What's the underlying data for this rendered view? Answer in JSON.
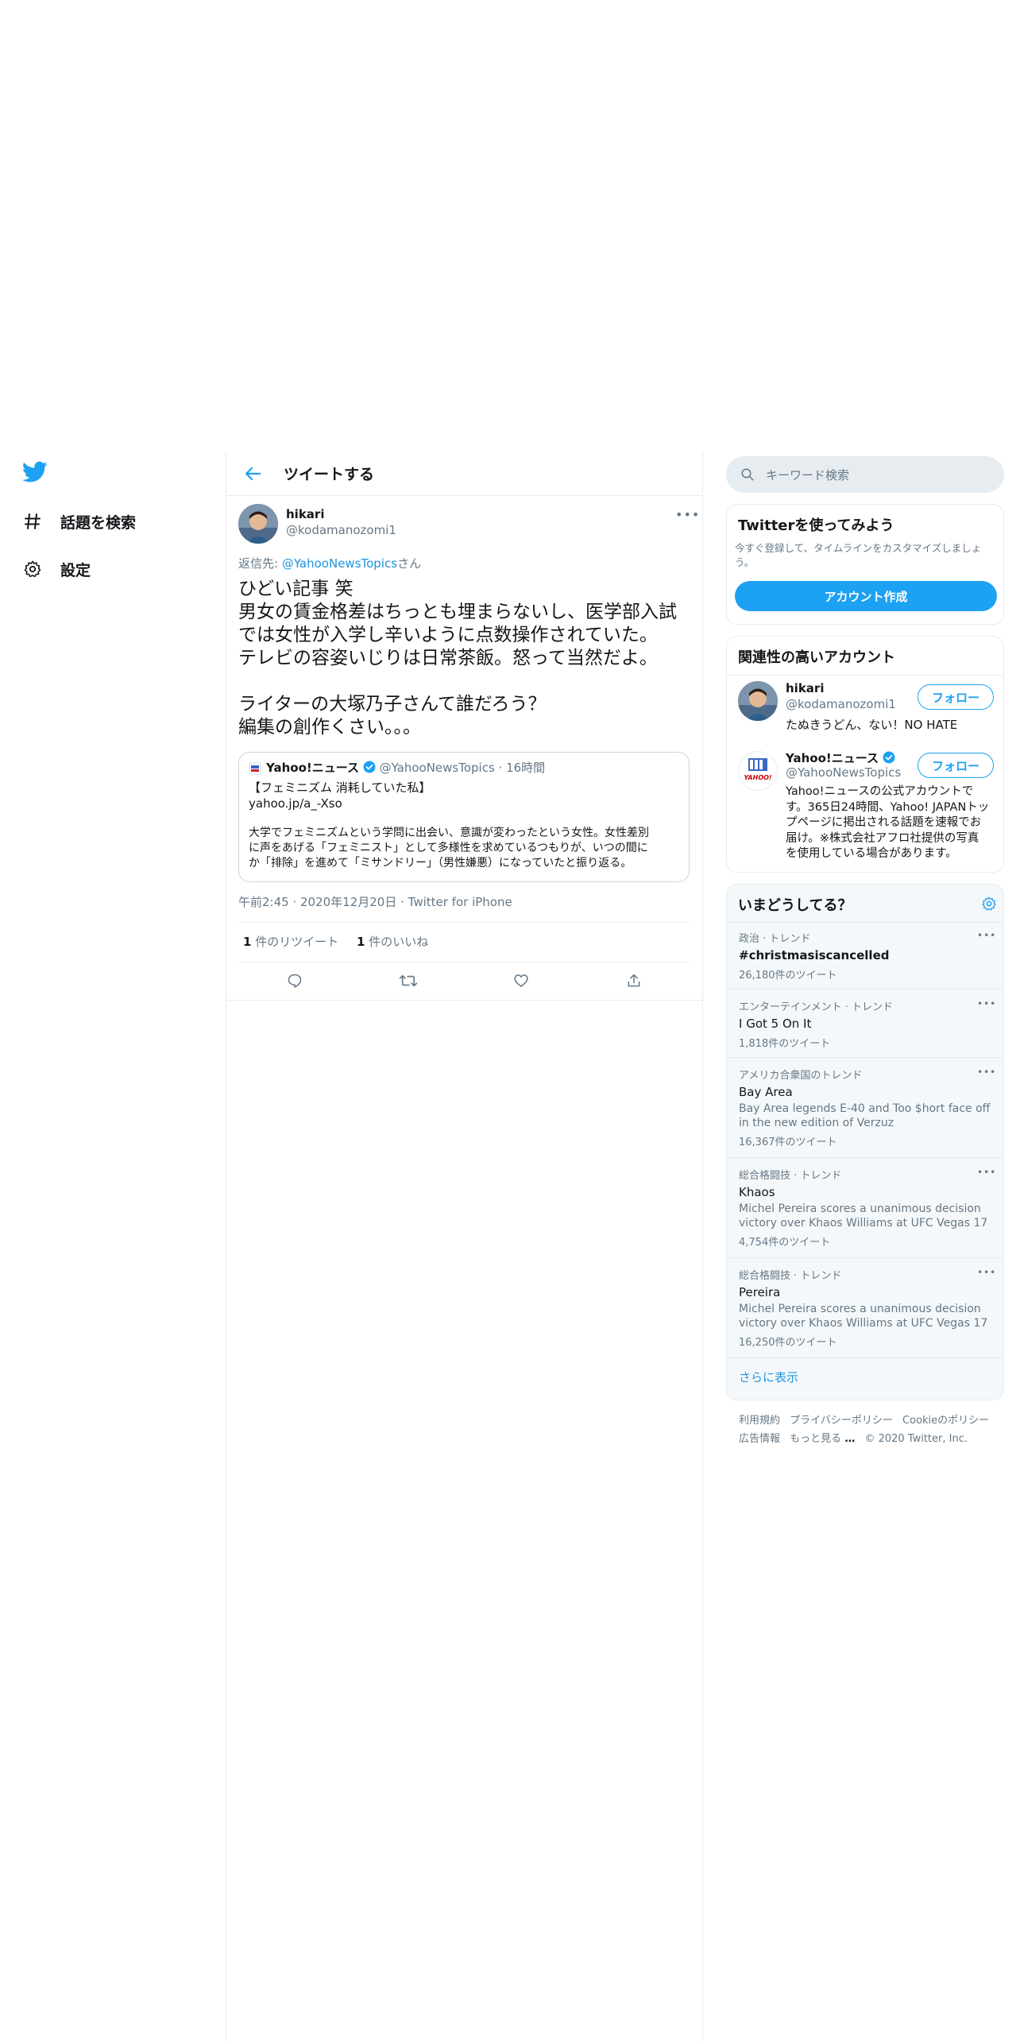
{
  "nav": {
    "explore_label": "話題を検索",
    "settings_label": "設定"
  },
  "header": {
    "title": "ツイートする"
  },
  "tweet": {
    "author_name": "hikari",
    "author_handle": "@kodamanozomi1",
    "reply_to_prefix": "返信先: ",
    "reply_to_mention": "@YahooNewsTopics",
    "reply_to_suffix": "さん",
    "text_line1": "ひどい記事 笑",
    "text_line2": "男女の賃金格差はちっとも埋まらないし、医学部入試",
    "text_line3": "では女性が入学し辛いように点数操作されていた。",
    "text_line4": "テレビの容姿いじりは日常茶飯。怒って当然だよ。",
    "text_line5": "ライターの大塚乃子さんて誰だろう？",
    "text_line6": "編集の創作くさい。。。",
    "quote": {
      "name": "Yahoo!ニュース",
      "handle_time": "@YahooNewsTopics · 16時間",
      "title": "【フェミニズム 消耗していた私】",
      "link": "yahoo.jp/a_-Xso",
      "body_line1": "大学でフェミニズムという学問に出会い、意識が変わったという女性。女性差別",
      "body_line2": "に声をあげる「フェミニスト」として多様性を求めているつもりが、いつの間に",
      "body_line3": "か「排除」を進めて「ミサンドリー」（男性嫌悪）になっていたと振り返る。"
    },
    "meta": "午前2:45 · 2020年12月20日 · Twitter for iPhone",
    "retweet_count": "1",
    "retweet_label": " 件のリツイート",
    "like_count": "1",
    "like_label": " 件のいいね"
  },
  "search": {
    "placeholder": "キーワード検索"
  },
  "signup": {
    "title": "Twitterを使ってみよう",
    "desc_line1": "今すぐ登録して、タイムラインをカスタマイズしましょ",
    "desc_line2": "う。",
    "button": "アカウント作成"
  },
  "relevant": {
    "title": "関連性の高いアカウント",
    "accounts": [
      {
        "name": "hikari",
        "handle": "@kodamanozomi1",
        "bio": "たぬきうどん、ない！NO HATE",
        "follow": "フォロー"
      },
      {
        "name": "Yahoo!ニュース",
        "handle": "@YahooNewsTopics",
        "bio_line1": "Yahoo!ニュースの公式アカウントで",
        "bio_line2": "す。365日24時間、Yahoo! JAPANトッ",
        "bio_line3": "プページに掲出される話題を速報でお",
        "bio_line4": "届け。※株式会社アフロ社提供の写真",
        "bio_line5": "を使用している場合があります。",
        "follow": "フォロー",
        "logo_text": "YAHOO!"
      }
    ]
  },
  "trends": {
    "title": "いまどうしてる？",
    "items": [
      {
        "ctx": "政治 · トレンド",
        "name": "#christmasiscancelled",
        "count": "26,180件のツイート"
      },
      {
        "ctx": "エンターテインメント · トレンド",
        "name": "I Got 5 On It",
        "count": "1,818件のツイート"
      },
      {
        "ctx": "アメリカ合衆国のトレンド",
        "name": "Bay Area",
        "desc_line1": "Bay Area legends E-40 and Too $hort face off",
        "desc_line2": "in the new edition of Verzuz",
        "count": "16,367件のツイート"
      },
      {
        "ctx": "総合格闘技 · トレンド",
        "name": "Khaos",
        "desc_line1": "Michel Pereira scores a unanimous decision",
        "desc_line2": "victory over Khaos Williams at UFC Vegas 17",
        "count": "4,754件のツイート"
      },
      {
        "ctx": "総合格闘技 · トレンド",
        "name": "Pereira",
        "desc_line1": "Michel Pereira scores a unanimous decision",
        "desc_line2": "victory over Khaos Williams at UFC Vegas 17",
        "count": "16,250件のツイート"
      }
    ],
    "more": "さらに表示"
  },
  "footer": {
    "terms": "利用規約",
    "privacy": "プライバシーポリシー",
    "cookie": "Cookieのポリシー",
    "ads": "広告情報",
    "more": "もっと見る",
    "copyright": "© 2020 Twitter, Inc."
  },
  "colors": {
    "accent": "#1da1f2",
    "link": "#1b95e0",
    "muted": "#657786"
  }
}
